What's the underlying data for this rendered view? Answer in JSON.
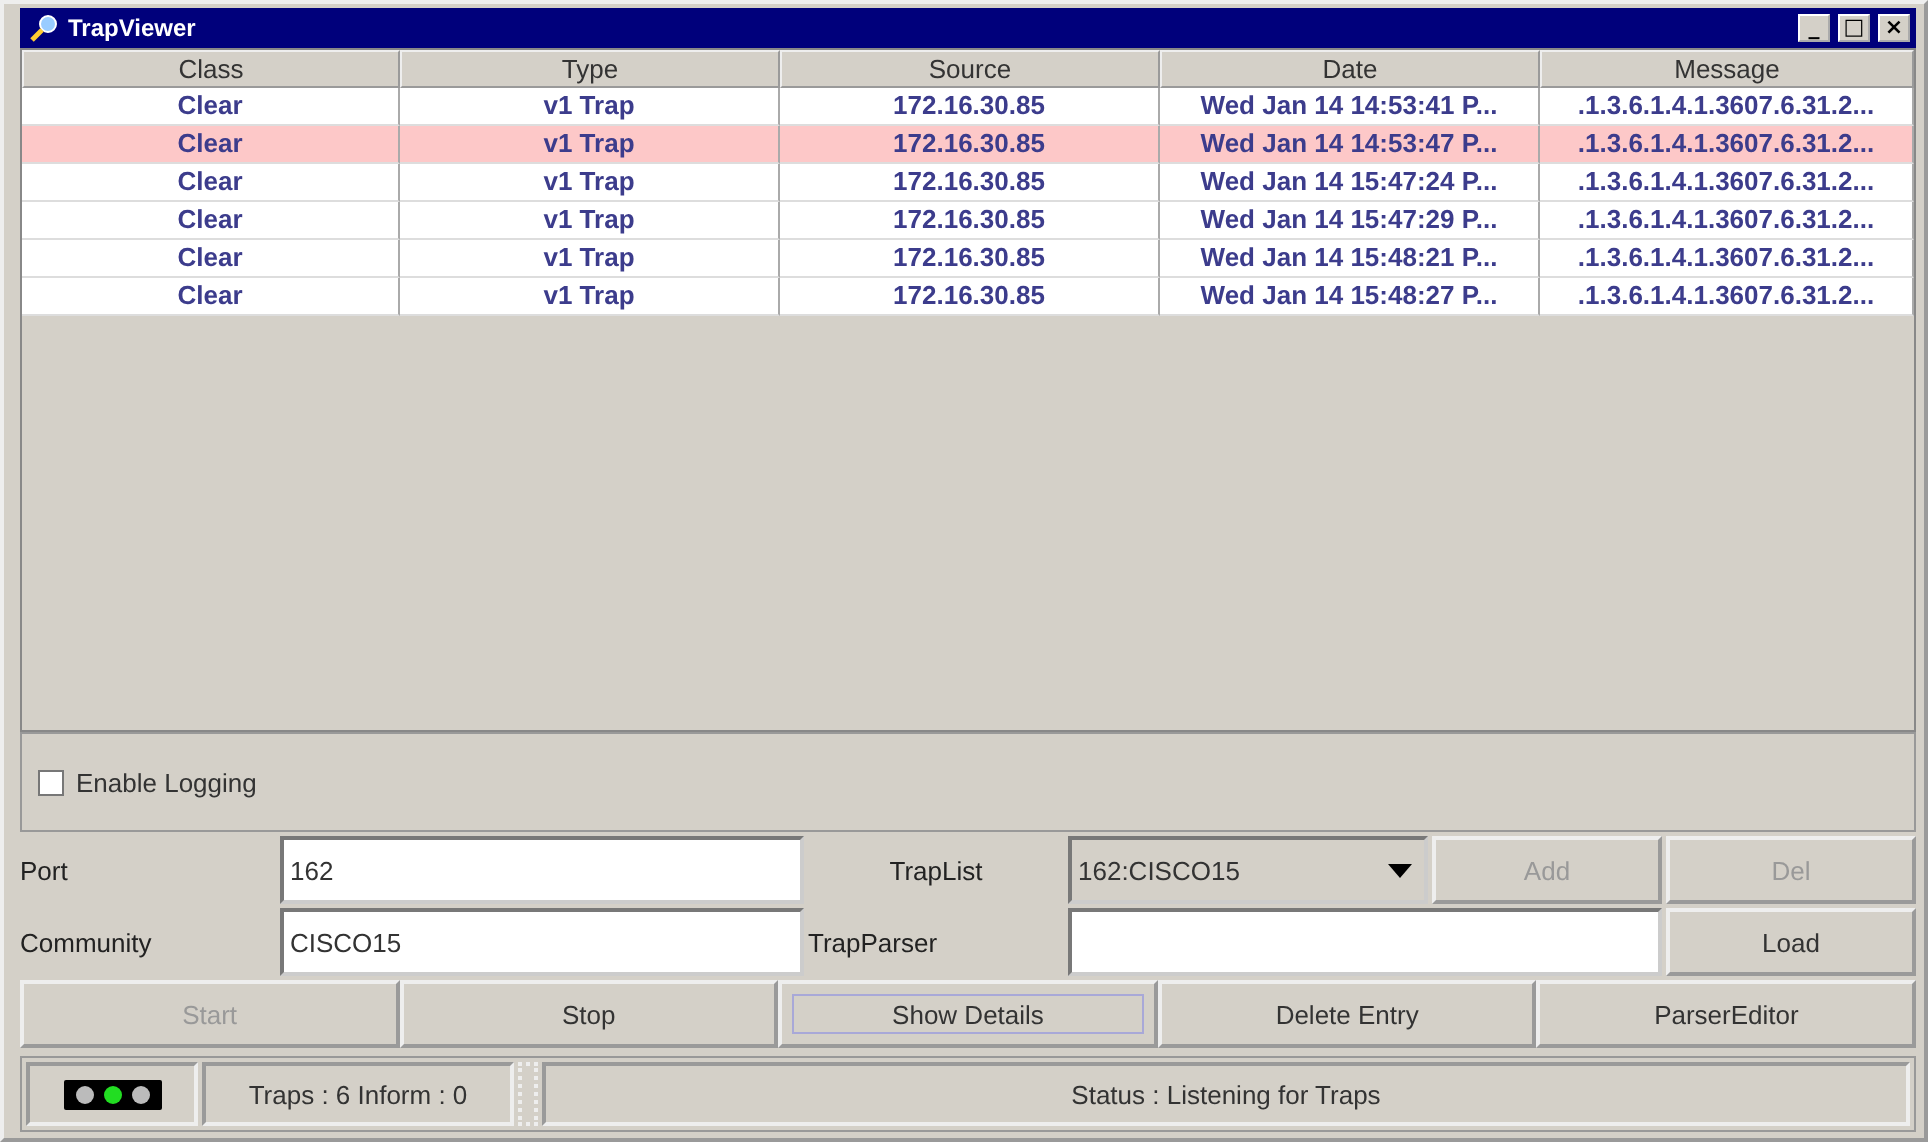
{
  "window": {
    "title": "TrapViewer",
    "controls": [
      "_",
      "□",
      "×"
    ]
  },
  "table": {
    "columns": [
      "Class",
      "Type",
      "Source",
      "Date",
      "Message"
    ],
    "rows": [
      {
        "cells": [
          "Clear",
          "v1 Trap",
          "172.16.30.85",
          "Wed Jan 14 14:53:41 P...",
          ".1.3.6.1.4.1.3607.6.31.2..."
        ],
        "selected": false
      },
      {
        "cells": [
          "Clear",
          "v1 Trap",
          "172.16.30.85",
          "Wed Jan 14 14:53:47 P...",
          ".1.3.6.1.4.1.3607.6.31.2..."
        ],
        "selected": true
      },
      {
        "cells": [
          "Clear",
          "v1 Trap",
          "172.16.30.85",
          "Wed Jan 14 15:47:24 P...",
          ".1.3.6.1.4.1.3607.6.31.2..."
        ],
        "selected": false
      },
      {
        "cells": [
          "Clear",
          "v1 Trap",
          "172.16.30.85",
          "Wed Jan 14 15:47:29 P...",
          ".1.3.6.1.4.1.3607.6.31.2..."
        ],
        "selected": false
      },
      {
        "cells": [
          "Clear",
          "v1 Trap",
          "172.16.30.85",
          "Wed Jan 14 15:48:21 P...",
          ".1.3.6.1.4.1.3607.6.31.2..."
        ],
        "selected": false
      },
      {
        "cells": [
          "Clear",
          "v1 Trap",
          "172.16.30.85",
          "Wed Jan 14 15:48:27 P...",
          ".1.3.6.1.4.1.3607.6.31.2..."
        ],
        "selected": false
      }
    ]
  },
  "logging": {
    "label": "Enable Logging",
    "checked": false
  },
  "form": {
    "port_label": "Port",
    "port": "162",
    "traplist_label": "TrapList",
    "traplist": "162:CISCO15",
    "add": {
      "label": "Add",
      "disabled": true
    },
    "del": {
      "label": "Del",
      "disabled": true
    },
    "community_label": "Community",
    "community": "CISCO15",
    "trapparser_label": "TrapParser",
    "load": {
      "label": "Load",
      "disabled": false
    }
  },
  "buttons": [
    {
      "label": "Start",
      "disabled": true,
      "focused": false
    },
    {
      "label": "Stop",
      "disabled": false,
      "focused": false
    },
    {
      "label": "Show Details",
      "disabled": false,
      "focused": true
    },
    {
      "label": "Delete Entry",
      "disabled": false,
      "focused": false
    },
    {
      "label": "ParserEditor",
      "disabled": false,
      "focused": false
    }
  ],
  "status_bar": {
    "lights": [
      {
        "on": false
      },
      {
        "on": true
      },
      {
        "on": false
      }
    ],
    "counts": "Traps : 6 Inform : 0",
    "status": "Status : Listening for Traps"
  }
}
